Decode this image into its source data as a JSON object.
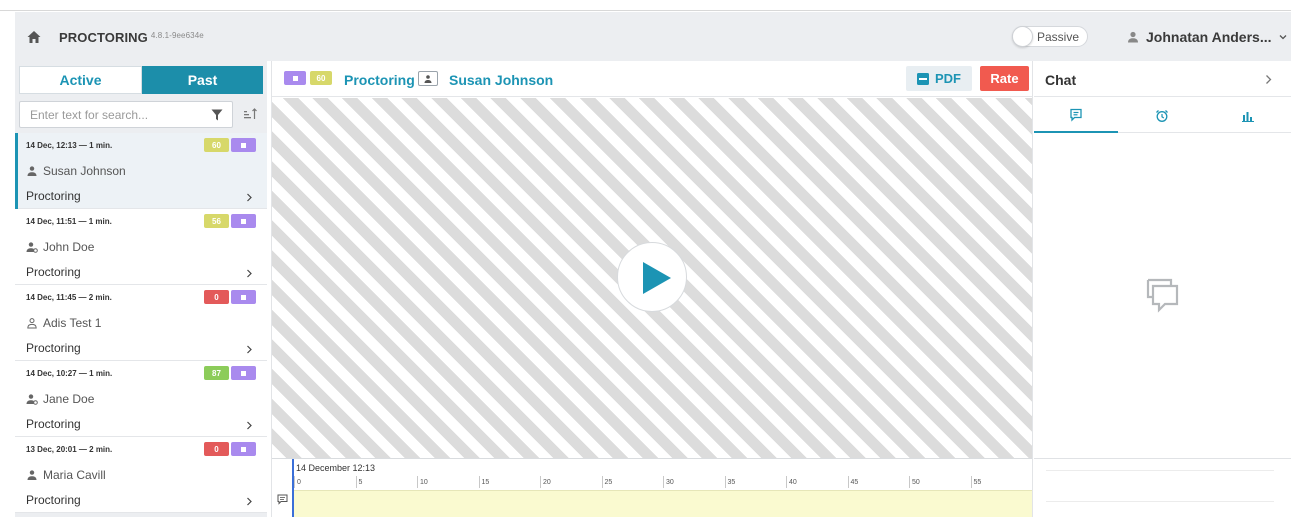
{
  "app": {
    "title": "PROCTORING",
    "version": "4.8.1-9ee634e",
    "mode_label": "Passive",
    "user_name": "Johnatan Anders..."
  },
  "sidebar": {
    "tabs": [
      {
        "label": "Active",
        "selected": false
      },
      {
        "label": "Past",
        "selected": true
      }
    ],
    "search": {
      "placeholder": "Enter text for search...",
      "value": ""
    },
    "items": [
      {
        "date": "14 Dec, 12:13 — 1 min.",
        "score": "60",
        "score_color": "#d7d86a",
        "user": "Susan Johnson",
        "user_icon": "person-icon",
        "type": "Proctoring",
        "selected": true
      },
      {
        "date": "14 Dec, 11:51 — 1 min.",
        "score": "56",
        "score_color": "#d7d86a",
        "user": "John Doe",
        "user_icon": "person-shield-icon",
        "type": "Proctoring",
        "selected": false
      },
      {
        "date": "14 Dec, 11:45 — 2 min.",
        "score": "0",
        "score_color": "#e35a5a",
        "user": "Adis Test 1",
        "user_icon": "person-outline-icon",
        "type": "Proctoring",
        "selected": false
      },
      {
        "date": "14 Dec, 10:27 — 1 min.",
        "score": "87",
        "score_color": "#8ccc5a",
        "user": "Jane Doe",
        "user_icon": "person-shield-icon",
        "type": "Proctoring",
        "selected": false
      },
      {
        "date": "13 Dec, 20:01 — 2 min.",
        "score": "0",
        "score_color": "#e35a5a",
        "user": "Maria Cavill",
        "user_icon": "person-icon",
        "type": "Proctoring",
        "selected": false
      }
    ]
  },
  "session": {
    "score": "60",
    "title": "Proctoring",
    "user_name": "Susan Johnson",
    "pdf_label": "PDF",
    "rate_label": "Rate",
    "timeline": {
      "label": "14 December 12:13",
      "ticks": [
        "0",
        "5",
        "10",
        "15",
        "20",
        "25",
        "30",
        "35",
        "40",
        "45",
        "50",
        "55"
      ]
    }
  },
  "chat": {
    "title": "Chat",
    "tabs": [
      "chat-icon",
      "alarm-icon",
      "bar-chart-icon"
    ]
  },
  "colors": {
    "accent": "#1c94b4",
    "accent_dark": "#1c8eaa",
    "purple": "#a98aee",
    "rate_red": "#f15a4f",
    "yellow_badge": "#d7d86a"
  }
}
